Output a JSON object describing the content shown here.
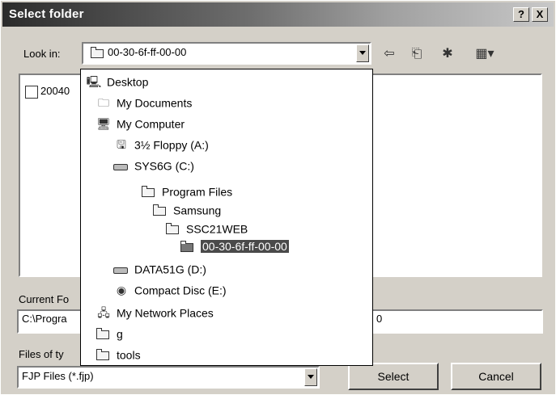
{
  "title": "Select folder",
  "title_buttons": {
    "help": "?",
    "close": "X"
  },
  "look_in": {
    "label": "Look in:",
    "value": "00-30-6f-ff-00-00"
  },
  "list_pane": {
    "items": [
      "20040"
    ]
  },
  "dropdown": {
    "items": [
      {
        "label": "Desktop",
        "icon": "desktop-icon"
      },
      {
        "label": "My Documents",
        "icon": "documents-icon"
      },
      {
        "label": "My Computer",
        "icon": "computer-icon"
      },
      {
        "label": "3½ Floppy (A:)",
        "icon": "floppy-icon"
      },
      {
        "label": "SYS6G (C:)",
        "icon": "drive-icon"
      },
      {
        "label": "Program Files",
        "icon": "folder-icon"
      },
      {
        "label": "Samsung",
        "icon": "folder-icon"
      },
      {
        "label": "SSC21WEB",
        "icon": "folder-icon"
      },
      {
        "label": "00-30-6f-ff-00-00",
        "icon": "open-folder-icon",
        "selected": true
      },
      {
        "label": "DATA51G (D:)",
        "icon": "drive-icon"
      },
      {
        "label": "Compact Disc (E:)",
        "icon": "cd-icon"
      },
      {
        "label": "My Network Places",
        "icon": "network-icon"
      },
      {
        "label": "g",
        "icon": "folder-icon"
      },
      {
        "label": "tools",
        "icon": "folder-icon"
      }
    ]
  },
  "current_folder": {
    "label": "Current Fo",
    "value": "C:\\Progra",
    "value_tail": "0"
  },
  "files_of_type": {
    "label": "Files of ty",
    "value": "FJP Files (*.fjp)"
  },
  "buttons": {
    "select": "Select",
    "cancel": "Cancel"
  }
}
